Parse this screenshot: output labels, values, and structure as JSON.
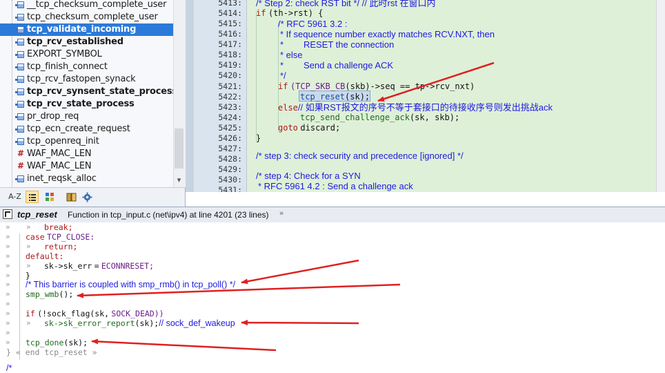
{
  "symbols": {
    "items": [
      {
        "label": "__tcp_checksum_complete_user",
        "kind": "function",
        "bold": false,
        "selected": false
      },
      {
        "label": "tcp_checksum_complete_user",
        "kind": "function",
        "bold": false,
        "selected": false
      },
      {
        "label": "tcp_validate_incoming",
        "kind": "function",
        "bold": true,
        "selected": true
      },
      {
        "label": "tcp_rcv_established",
        "kind": "function",
        "bold": true,
        "selected": false
      },
      {
        "label": "EXPORT_SYMBOL",
        "kind": "function",
        "bold": false,
        "selected": false
      },
      {
        "label": "tcp_finish_connect",
        "kind": "function",
        "bold": false,
        "selected": false
      },
      {
        "label": "tcp_rcv_fastopen_synack",
        "kind": "function",
        "bold": false,
        "selected": false
      },
      {
        "label": "tcp_rcv_synsent_state_process",
        "kind": "function",
        "bold": true,
        "selected": false
      },
      {
        "label": "tcp_rcv_state_process",
        "kind": "function",
        "bold": true,
        "selected": false
      },
      {
        "label": "pr_drop_req",
        "kind": "function",
        "bold": false,
        "selected": false
      },
      {
        "label": "tcp_ecn_create_request",
        "kind": "function",
        "bold": false,
        "selected": false
      },
      {
        "label": "tcp_openreq_init",
        "kind": "function",
        "bold": false,
        "selected": false
      },
      {
        "label": "WAF_MAC_LEN",
        "kind": "macro",
        "bold": false,
        "selected": false
      },
      {
        "label": "WAF_MAC_LEN",
        "kind": "macro",
        "bold": false,
        "selected": false
      },
      {
        "label": "inet_reqsk_alloc",
        "kind": "function",
        "bold": false,
        "selected": false
      }
    ],
    "toolbar": {
      "sort_label": "A-Z"
    }
  },
  "editor": {
    "line_numbers": [
      "5413:",
      "5414:",
      "5415:",
      "5416:",
      "5417:",
      "5418:",
      "5419:",
      "5420:",
      "5421:",
      "5422:",
      "5423:",
      "5424:",
      "5425:",
      "5426:",
      "5427:",
      "5428:",
      "5429:",
      "5430:",
      "5431:"
    ],
    "lines": {
      "l5413": "/* Step 2: check RST bit */ // 此时rst 在窗口内",
      "l5414_kw": "if",
      "l5414_rest": "(th->rst) {",
      "l5415": "/* RFC 5961 3.2 :",
      "l5416": "* If sequence number exactly matches RCV.NXT, then",
      "l5417": "*        RESET the connection",
      "l5418": "* else",
      "l5419": "*        Send a challenge ACK",
      "l5420": "*/",
      "l5421_kw": "if",
      "l5421_mac": "(TCP_SKB_CB",
      "l5421_rest": "(skb)->seq == tp->rcv_nxt)",
      "l5422_fn": "tcp_reset",
      "l5422_rest": "(sk);",
      "l5423_kw": "else",
      "l5423_cmt": "// 如果RST报文的序号不等于套接口的待接收序号则发出挑战ack",
      "l5424_fn": "tcp_send_challenge_ack",
      "l5424_rest": "(sk, skb);",
      "l5425_kw": "goto",
      "l5425_rest": "discard;",
      "l5426": "}",
      "l5427": "",
      "l5428": "/* step 3: check security and precedence [ignored] */",
      "l5429": "",
      "l5430": "/* step 4: Check for a SYN",
      "l5431": "* RFC 5961 4.2 : Send a challenge ack"
    }
  },
  "reference": {
    "symbol_name": "tcp_reset",
    "description": "Function in tcp_input.c (net\\ipv4) at line 4201 (23 lines)",
    "marker": "»",
    "lines": {
      "r1_kw": "break;",
      "r2_kw": "case",
      "r2_mac": "TCP_CLOSE:",
      "r3_kw": "return;",
      "r4_kw": "default:",
      "r5_var": "sk->sk_err",
      "r5_eq": "=",
      "r5_mac": "ECONNRESET;",
      "r6": "}",
      "r7": "/* This barrier is coupled with smp_rmb() in tcp_poll() */",
      "r8_fn": "smp_wmb",
      "r8_rest": "();",
      "r9": "",
      "r10_kw": "if",
      "r10_rest": "(!sock_flag(sk,",
      "r10_mac": "SOCK_DEAD))",
      "r11_fn": "sk->sk_error_report",
      "r11_rest": "(sk);",
      "r11_cmt": "// sock_def_wakeup",
      "r12": "",
      "r13_fn": "tcp_done",
      "r13_rest": "(sk);",
      "r14": "} « end tcp_reset »",
      "r15": "",
      "r16": "/*"
    }
  },
  "colors": {
    "editor_bg": "#dff0d8",
    "selection": "#2b7ad9",
    "arrow": "#e02020",
    "comment": "#1d1ae0",
    "keyword": "#b01717"
  }
}
